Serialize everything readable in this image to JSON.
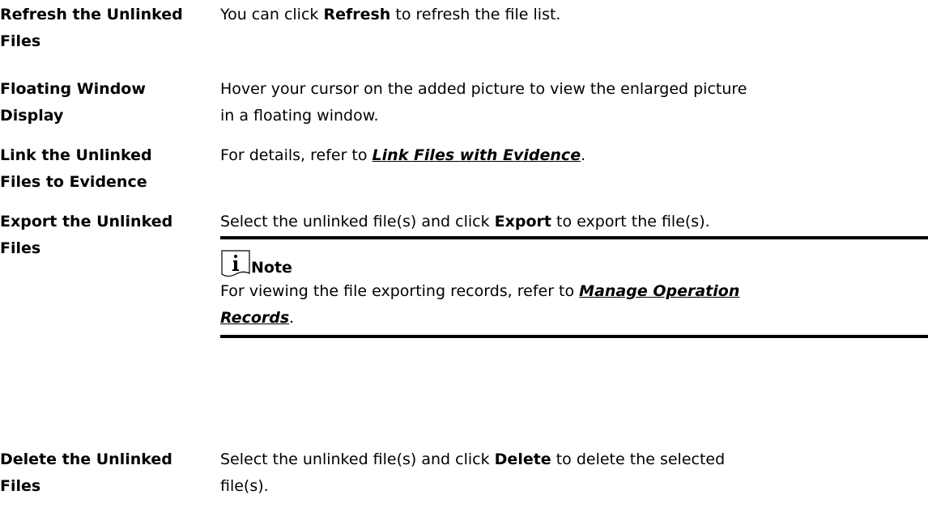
{
  "rows": [
    {
      "term_line1": "Refresh the Unlinked",
      "term_line2": "Files",
      "desc_before": "You can click ",
      "desc_bold": "Refresh",
      "desc_after": " to refresh the file list."
    },
    {
      "term_line1": "Floating Window",
      "term_line2": "Display",
      "desc_line1": "Hover your cursor on the added picture to view the enlarged picture",
      "desc_line2": "in a floating window."
    },
    {
      "term_line1": "Link the Unlinked",
      "term_line2": "Files to Evidence",
      "desc_before": "For details, refer to ",
      "desc_link": "Link Files with Evidence",
      "desc_after": "."
    },
    {
      "term_line1": "Export the Unlinked",
      "term_line2": "Files",
      "desc_before": "Select the unlinked file(s) and click ",
      "desc_bold": "Export",
      "desc_after": " to export the file(s)."
    },
    {
      "term_line1": "Delete the Unlinked",
      "term_line2": "Files",
      "desc_before": "Select the unlinked file(s) and click ",
      "desc_bold": "Delete",
      "desc_after": " to delete the selected",
      "desc_line2": "file(s)."
    }
  ],
  "note": {
    "icon": "info-note-icon",
    "title": "Note",
    "text_before": "For viewing the file exporting records, refer to ",
    "link_line1": "Manage Operation",
    "link_line2": "Records",
    "text_after": "."
  }
}
